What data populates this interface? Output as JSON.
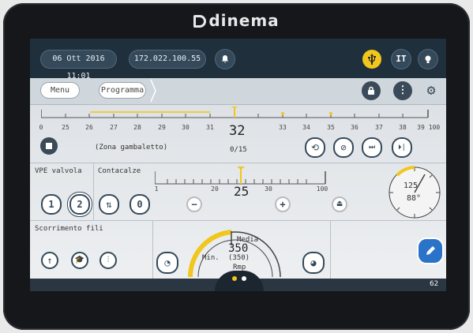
{
  "brand": {
    "name": "dinema"
  },
  "status": {
    "datetime": "06 Ott 2016 11:01",
    "ip": "172.022.100.55",
    "lang": "IT"
  },
  "nav": {
    "menu": "Menu",
    "programma": "Programma"
  },
  "ruler": {
    "ticks": [
      "0",
      "25",
      "26",
      "27",
      "28",
      "29",
      "30",
      "31",
      "33",
      "34",
      "35",
      "36",
      "37",
      "38",
      "39",
      "100"
    ],
    "current": "32",
    "count": "0/15",
    "program_name": "(Zona gambaletto)"
  },
  "vpe": {
    "label": "VPE valvola",
    "btn1": "1",
    "btn2": "2"
  },
  "contacalze": {
    "label": "Contacalze",
    "btn0": "0",
    "value": "25",
    "scale": [
      "1",
      "20",
      "30",
      "100"
    ]
  },
  "gauge": {
    "value1": "125",
    "value2": "88°"
  },
  "scorrimento": {
    "label": "Scorrimento fili"
  },
  "speed": {
    "media_label": "Media",
    "value": "350",
    "min_label": "Min.",
    "min_value": "(350)",
    "unit": "Rmp"
  },
  "footer": {
    "page_number": "62"
  },
  "colors": {
    "accent": "#f1c61d",
    "dark": "#1f2f3c",
    "blue": "#2b73c8"
  }
}
